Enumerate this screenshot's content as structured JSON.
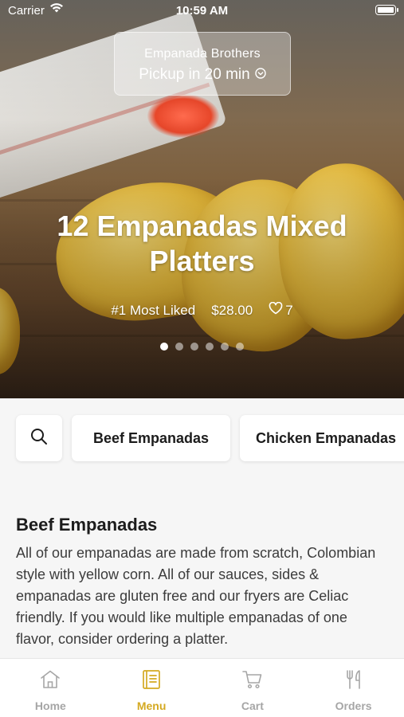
{
  "status_bar": {
    "carrier": "Carrier",
    "time": "10:59 AM"
  },
  "restaurant": {
    "name": "Empanada Brothers",
    "pickup": "Pickup in 20 min"
  },
  "featured": {
    "title": "12 Empanadas Mixed Platters",
    "badge": "#1 Most Liked",
    "price": "$28.00",
    "likes": "7",
    "slide_count": 6,
    "active_slide": 1
  },
  "categories": [
    "Beef Empanadas",
    "Chicken Empanadas"
  ],
  "section": {
    "title": "Beef Empanadas",
    "description": "All of our empanadas are made from scratch, Colombian style with yellow corn. All of our sauces, sides & empanadas are gluten free and our fryers are Celiac friendly. If you would like multiple empanadas of one flavor, consider ordering a platter."
  },
  "tabs": [
    {
      "label": "Home",
      "icon": "home-icon"
    },
    {
      "label": "Menu",
      "icon": "menu-book-icon",
      "active": true
    },
    {
      "label": "Cart",
      "icon": "cart-icon"
    },
    {
      "label": "Orders",
      "icon": "fork-knife-icon"
    }
  ],
  "colors": {
    "accent": "#d4a921",
    "inactive_tab": "#a6a6a6",
    "background": "#f6f6f6"
  }
}
